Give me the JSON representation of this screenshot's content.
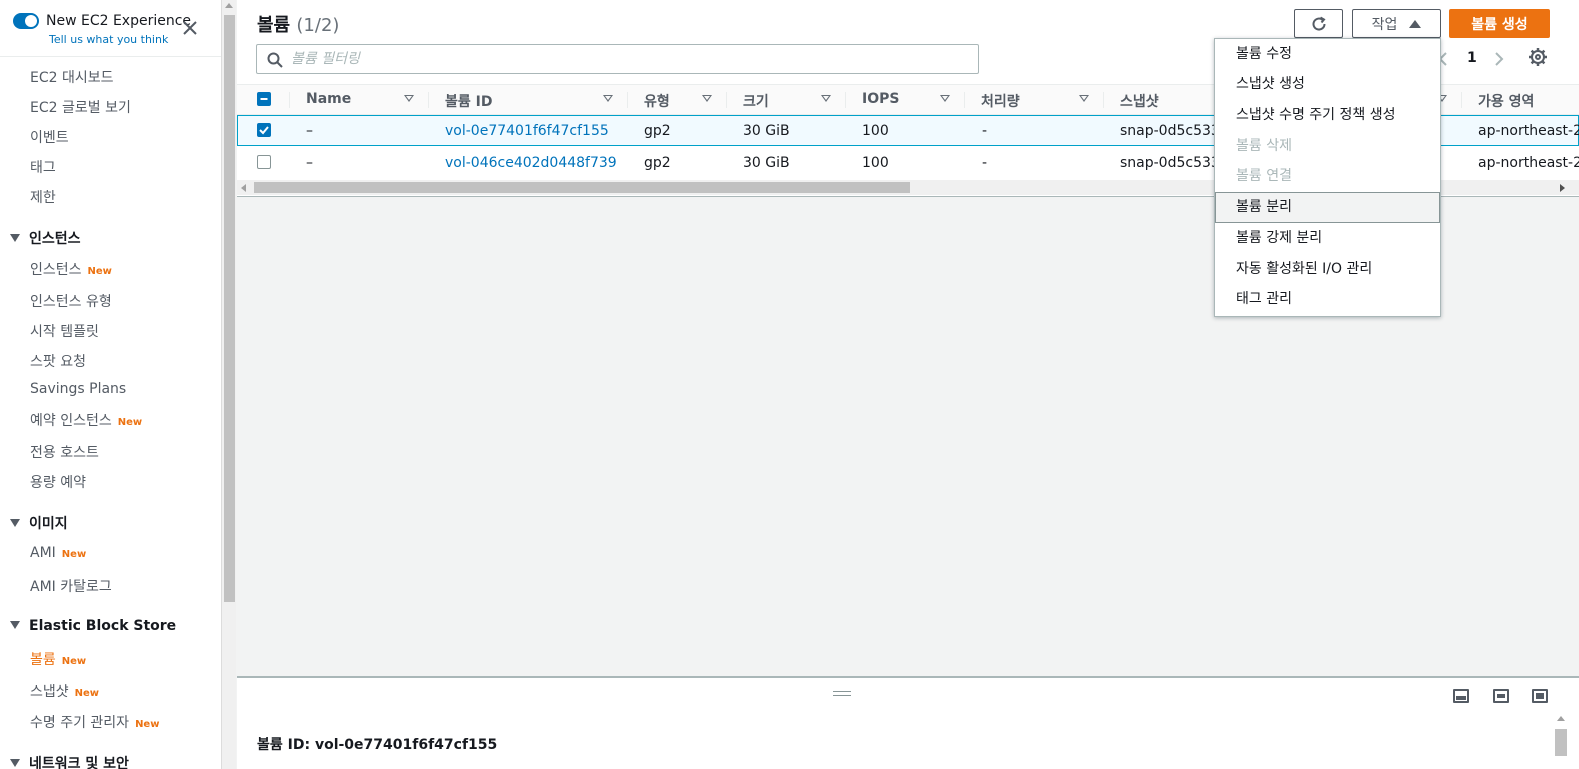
{
  "sidebar": {
    "experience_title": "New EC2 Experience",
    "experience_sub": "Tell us what you think",
    "new_badge": "New",
    "top_items": [
      "EC2 대시보드",
      "EC2 글로벌 보기",
      "이벤트",
      "태그",
      "제한"
    ],
    "sections": [
      {
        "title": "인스턴스",
        "items": [
          {
            "label": "인스턴스",
            "badge": true
          },
          {
            "label": "인스턴스 유형",
            "badge": false
          },
          {
            "label": "시작 템플릿",
            "badge": false
          },
          {
            "label": "스팟 요청",
            "badge": false
          },
          {
            "label": "Savings Plans",
            "badge": false
          },
          {
            "label": "예약 인스턴스",
            "badge": true
          },
          {
            "label": "전용 호스트",
            "badge": false
          },
          {
            "label": "용량 예약",
            "badge": false
          }
        ]
      },
      {
        "title": "이미지",
        "items": [
          {
            "label": "AMI",
            "badge": true
          },
          {
            "label": "AMI 카탈로그",
            "badge": false
          }
        ]
      },
      {
        "title": "Elastic Block Store",
        "items": [
          {
            "label": "볼륨",
            "badge": true
          },
          {
            "label": "스냅샷",
            "badge": true
          },
          {
            "label": "수명 주기 관리자",
            "badge": true
          }
        ]
      },
      {
        "title": "네트워크 및 보안",
        "items": []
      }
    ]
  },
  "header": {
    "title": "볼륨",
    "count": "(1/2)",
    "actions_label": "작업",
    "create_label": "볼륨 생성",
    "search_placeholder": "볼륨 필터링",
    "page": "1"
  },
  "table": {
    "columns": [
      "Name",
      "볼륨 ID",
      "유형",
      "크기",
      "IOPS",
      "처리량",
      "스냅샷",
      "가용 영역"
    ],
    "rows": [
      {
        "name": "–",
        "id": "vol-0e77401f6f47cf155",
        "type": "gp2",
        "size": "30 GiB",
        "iops": "100",
        "throughput": "-",
        "snapshot": "snap-0d5c533.",
        "az": "ap-northeast-2",
        "selected": true
      },
      {
        "name": "–",
        "id": "vol-046ce402d0448f739",
        "type": "gp2",
        "size": "30 GiB",
        "iops": "100",
        "throughput": "-",
        "snapshot": "snap-0d5c533.",
        "az": "ap-northeast-2",
        "selected": false
      }
    ]
  },
  "menu": {
    "items": [
      {
        "label": "볼륨 수정",
        "disabled": false
      },
      {
        "label": "스냅샷 생성",
        "disabled": false
      },
      {
        "label": "스냅샷 수명 주기 정책 생성",
        "disabled": false
      },
      {
        "label": "볼륨 삭제",
        "disabled": true
      },
      {
        "label": "볼륨 연결",
        "disabled": true
      },
      {
        "label": "볼륨 분리",
        "disabled": false,
        "hover": true
      },
      {
        "label": "볼륨 강제 분리",
        "disabled": false
      },
      {
        "label": "자동 활성화된 I/O 관리",
        "disabled": false
      },
      {
        "label": "태그 관리",
        "disabled": false
      }
    ]
  },
  "detail": {
    "label": "볼륨 ID:",
    "value": "vol-0e77401f6f47cf155"
  },
  "colors": {
    "accent": "#ec7211",
    "link": "#0073bb",
    "selected_border": "#00a1c9"
  }
}
